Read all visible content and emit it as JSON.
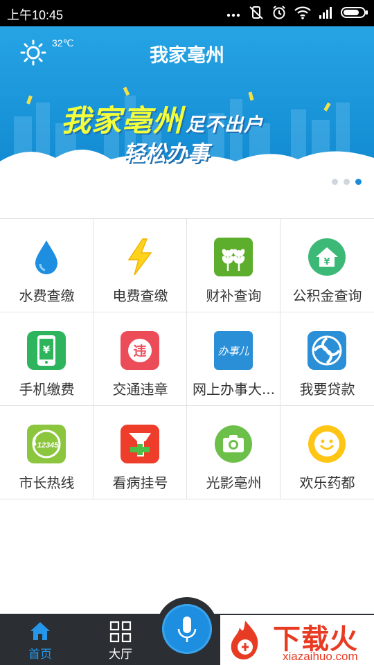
{
  "status_bar": {
    "time": "上午10:45"
  },
  "header": {
    "title": "我家亳州",
    "temperature": "32℃",
    "weather_icon": "sun-icon"
  },
  "banner": {
    "slogan_main": "我家亳州",
    "slogan_sub": "足不出户",
    "slogan_line2": "轻松办事",
    "page_indicator": {
      "count": 3,
      "active": 3
    }
  },
  "services": [
    {
      "label": "水费查缴",
      "icon": "water-drop-icon",
      "color": "#1e8ee0"
    },
    {
      "label": "电费查缴",
      "icon": "lightning-icon",
      "color": "#ffd21c"
    },
    {
      "label": "财补查询",
      "icon": "wheat-icon",
      "color": "#5dae2c"
    },
    {
      "label": "公积金查询",
      "icon": "house-yuan-icon",
      "color": "#3cb877"
    },
    {
      "label": "手机缴费",
      "icon": "phone-yuan-icon",
      "color": "#2fb45e"
    },
    {
      "label": "交通违章",
      "icon": "violation-icon",
      "color": "#ec4c57"
    },
    {
      "label": "网上办事大...",
      "icon": "banshier-icon",
      "color": "#2a8fd6",
      "icon_text": "办事儿"
    },
    {
      "label": "我要贷款",
      "icon": "loan-icon",
      "color": "#2a8fd6"
    },
    {
      "label": "市长热线",
      "icon": "hotline-icon",
      "color": "#8cc63f",
      "icon_text": "12345"
    },
    {
      "label": "看病挂号",
      "icon": "hospital-icon",
      "color": "#ee3d2a"
    },
    {
      "label": "光影亳州",
      "icon": "camera-icon",
      "color": "#6cc04a"
    },
    {
      "label": "欢乐药都",
      "icon": "smiley-icon",
      "color": "#ffc515"
    }
  ],
  "tabbar": {
    "home_label": "首页",
    "hall_label": "大厅",
    "active_color": "#2596e8",
    "voice_icon": "microphone-icon"
  },
  "watermark": {
    "title": "下载火",
    "site": "xiazaihuo.com"
  }
}
